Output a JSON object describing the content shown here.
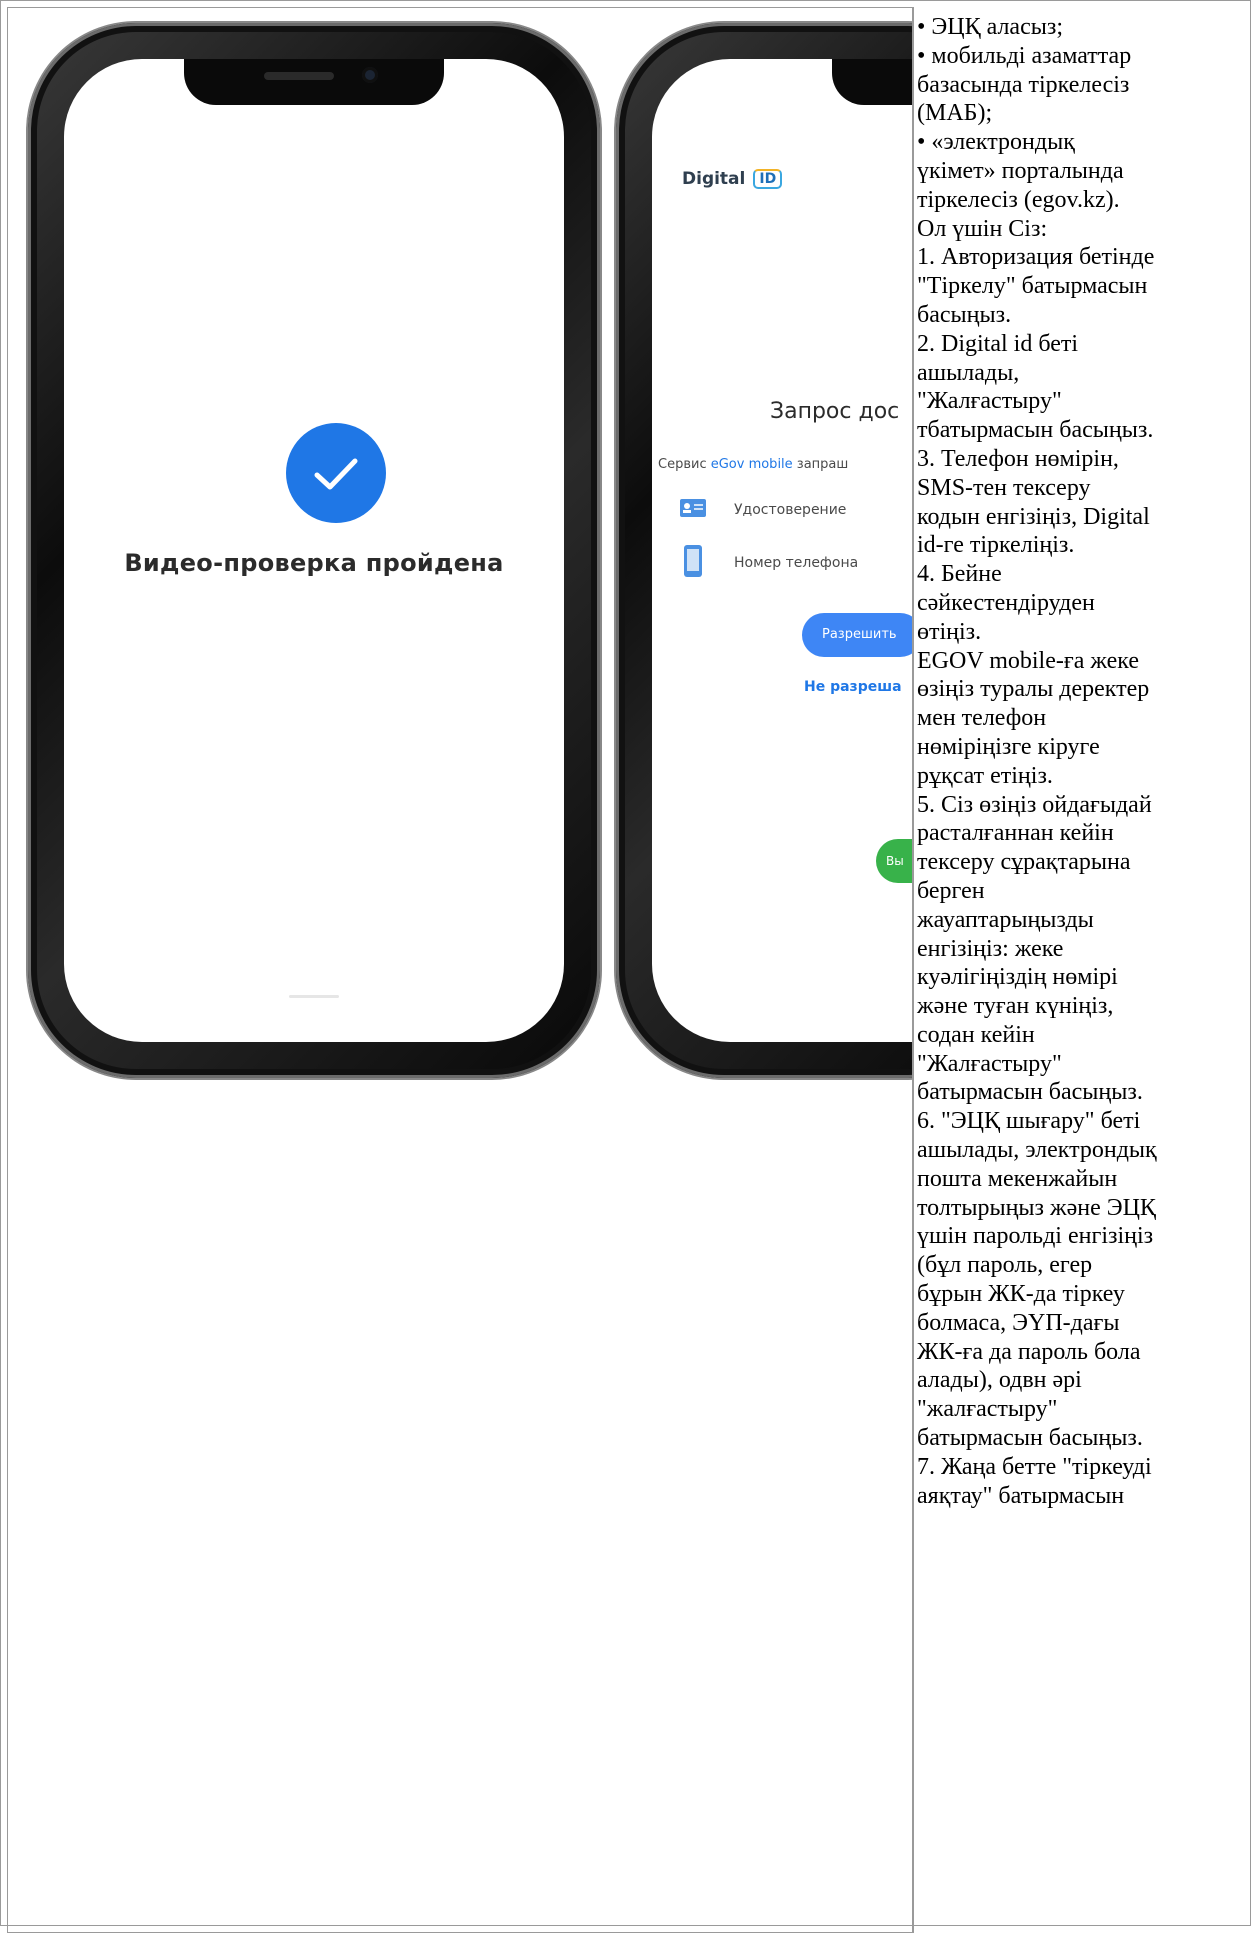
{
  "left_image": {
    "phone1": {
      "status_text": "Видео-проверка пройдена"
    },
    "phone2": {
      "logo_text": "Digital",
      "logo_id": "ID",
      "request_title": "Запрос дос",
      "service_prefix": "Сервис ",
      "service_name": "eGov mobile",
      "service_suffix": " запраш",
      "perm_id_label": "Удостоверение",
      "perm_phone_label": "Номер телефона",
      "allow_button": "Разрешить",
      "deny_link": "Не разреша",
      "green_button": "Вы"
    }
  },
  "instructions": {
    "lines": [
      "• ЭЦҚ аласыз;",
      "• мобильді азаматтар",
      "базасында тіркелесіз",
      "(МАБ);",
      "• «электрондық",
      "үкімет» порталында",
      "тіркелесіз (egov.kz).",
      "Ол үшін Сіз:",
      "1. Авторизация бетінде",
      "\"Тіркелу\" батырмасын",
      "басыңыз.",
      "2. Digital id беті",
      "ашылады,",
      "\"Жалғастыру\"",
      "тбатырмасын басыңыз.",
      "3. Телефон нөмірін,",
      "SMS-тен тексеру",
      "кодын енгізіңіз, Digital",
      "id-ге тіркеліңіз.",
      "4. Бейне",
      "сәйкестендіруден",
      "өтіңіз.",
      "EGOV mobile-ға жеке",
      "өзіңіз туралы  деректер",
      "мен телефон",
      "нөміріңізге кіруге",
      "рұқсат етіңіз.",
      "5. Сіз өзіңіз ойдағыдай",
      "расталғаннан кейін",
      "тексеру сұрақтарына",
      "берген",
      "жауаптарыңызды",
      "енгізіңіз: жеке",
      "куәлігіңіздің нөмірі",
      "және туған күніңіз,",
      "содан кейін",
      "\"Жалғастыру\"",
      "батырмасын басыңыз.",
      "6. \"ЭЦҚ шығару\" беті",
      "ашылады, электрондық",
      "пошта мекенжайын",
      "толтырыңыз және ЭЦҚ",
      "үшін парольді енгізіңіз",
      "(бұл пароль, егер",
      "бұрын ЖК-да тіркеу",
      "болмаса, ЭҮП-дағы",
      "ЖК-ға да пароль бола",
      "алады), одвн әрі",
      "\"жалғастыру\"",
      "батырмасын басыңыз.",
      "7. Жаңа бетте \"тіркеуді",
      "аяқтау\" батырмасын"
    ]
  },
  "colors": {
    "accent_blue": "#1f77e6",
    "button_blue": "#3e86f5",
    "green": "#38b24a"
  }
}
